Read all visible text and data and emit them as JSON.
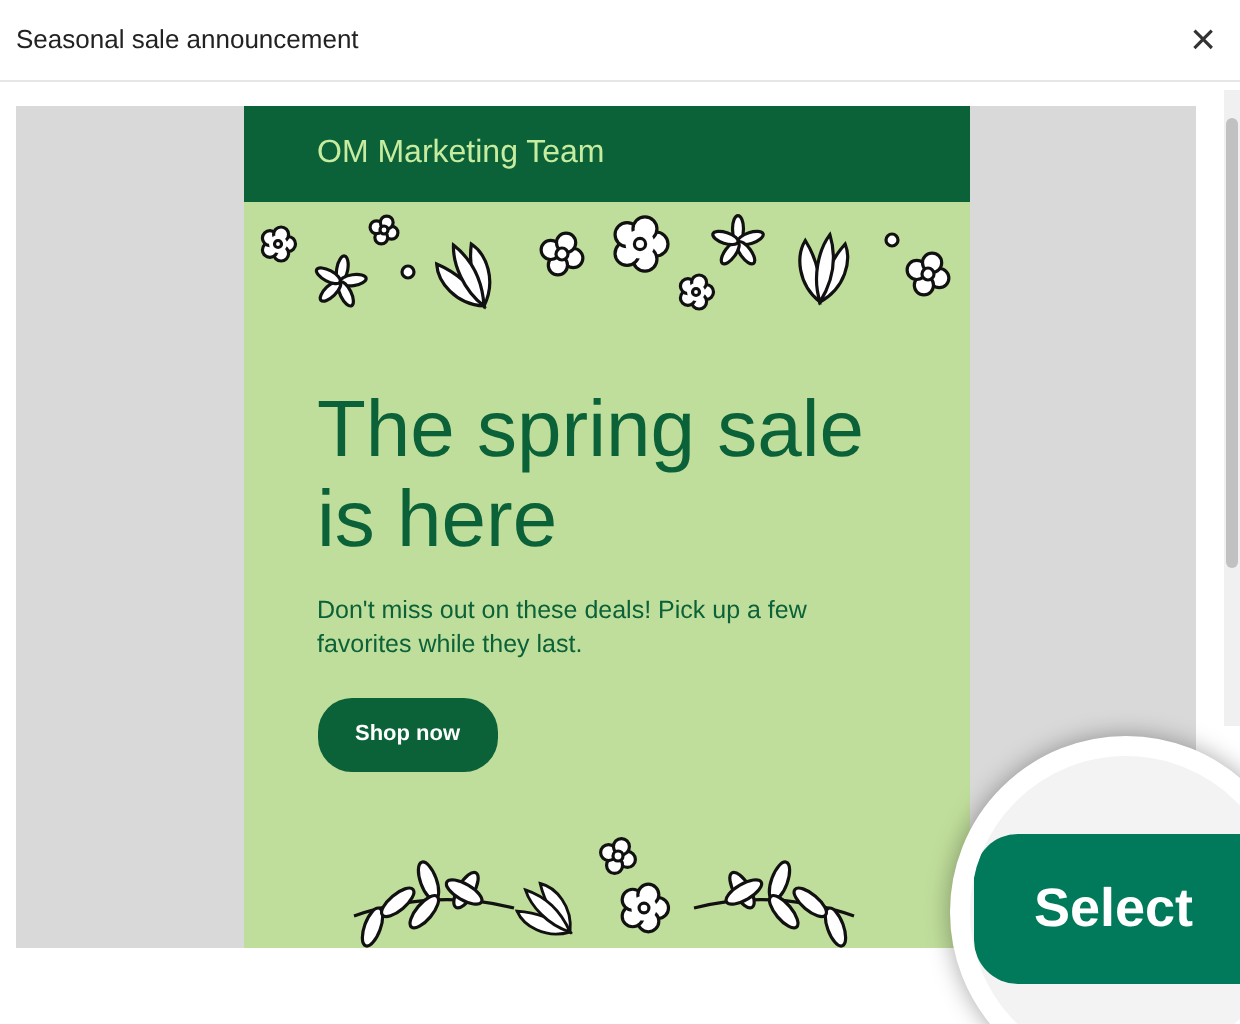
{
  "dialog": {
    "title": "Seasonal sale announcement",
    "close": "×"
  },
  "email": {
    "sender": "OM Marketing Team",
    "heading": "The spring sale is here",
    "body": "Don't miss out on these deals! Pick up a few favorites while they last.",
    "button": "Shop now"
  },
  "magnifier": {
    "button": "Select"
  }
}
